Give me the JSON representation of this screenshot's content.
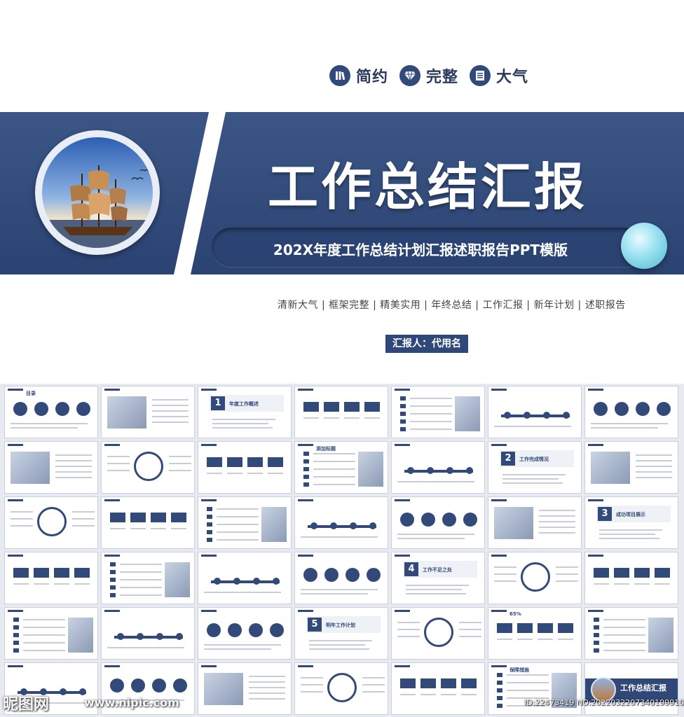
{
  "cover": {
    "features": [
      {
        "label": "简约",
        "icon": "books-icon"
      },
      {
        "label": "完整",
        "icon": "diamond-icon"
      },
      {
        "label": "大气",
        "icon": "document-icon"
      }
    ],
    "title": "工作总结汇报",
    "subtitle": "202X年度工作总结计划汇报述职报告PPT模版",
    "tags": "清新大气 | 框架完整 | 精美实用 | 年终总结 | 工作汇报 | 新年计划 | 述职报告",
    "reporter": "汇报人：代用名",
    "colors": {
      "primary": "#324a7a",
      "band": "#34507f",
      "accent": "#7fd6ea"
    }
  },
  "thumbnails": {
    "slides": [
      {
        "num": "",
        "title": "目录"
      },
      {
        "num": "",
        "title": ""
      },
      {
        "num": "1",
        "title": "年度工作概述"
      },
      {
        "num": "",
        "title": ""
      },
      {
        "num": "",
        "title": ""
      },
      {
        "num": "",
        "title": ""
      },
      {
        "num": "",
        "title": ""
      },
      {
        "num": "",
        "title": ""
      },
      {
        "num": "",
        "title": ""
      },
      {
        "num": "",
        "title": ""
      },
      {
        "num": "",
        "title": "添加标题"
      },
      {
        "num": "",
        "title": ""
      },
      {
        "num": "2",
        "title": "工作完成情况"
      },
      {
        "num": "",
        "title": ""
      },
      {
        "num": "",
        "title": ""
      },
      {
        "num": "",
        "title": ""
      },
      {
        "num": "",
        "title": ""
      },
      {
        "num": "",
        "title": ""
      },
      {
        "num": "",
        "title": ""
      },
      {
        "num": "",
        "title": ""
      },
      {
        "num": "3",
        "title": "成功项目展示"
      },
      {
        "num": "",
        "title": ""
      },
      {
        "num": "",
        "title": ""
      },
      {
        "num": "",
        "title": ""
      },
      {
        "num": "",
        "title": ""
      },
      {
        "num": "4",
        "title": "工作不足之处"
      },
      {
        "num": "",
        "title": ""
      },
      {
        "num": "",
        "title": ""
      },
      {
        "num": "",
        "title": ""
      },
      {
        "num": "",
        "title": ""
      },
      {
        "num": "",
        "title": ""
      },
      {
        "num": "5",
        "title": "明年工作计划"
      },
      {
        "num": "",
        "title": ""
      },
      {
        "num": "",
        "title": "65%"
      },
      {
        "num": "",
        "title": ""
      },
      {
        "num": "",
        "title": ""
      },
      {
        "num": "",
        "title": ""
      },
      {
        "num": "",
        "title": ""
      },
      {
        "num": "",
        "title": ""
      },
      {
        "num": "",
        "title": ""
      },
      {
        "num": "",
        "title": "保障措施"
      },
      {
        "num": "",
        "title": ""
      }
    ],
    "last_cover_title": "工作总结汇报"
  },
  "watermark": {
    "logo": "昵图网",
    "url": "www.nipic.com",
    "id": "ID:22473419 NO:20220322073401999104"
  }
}
